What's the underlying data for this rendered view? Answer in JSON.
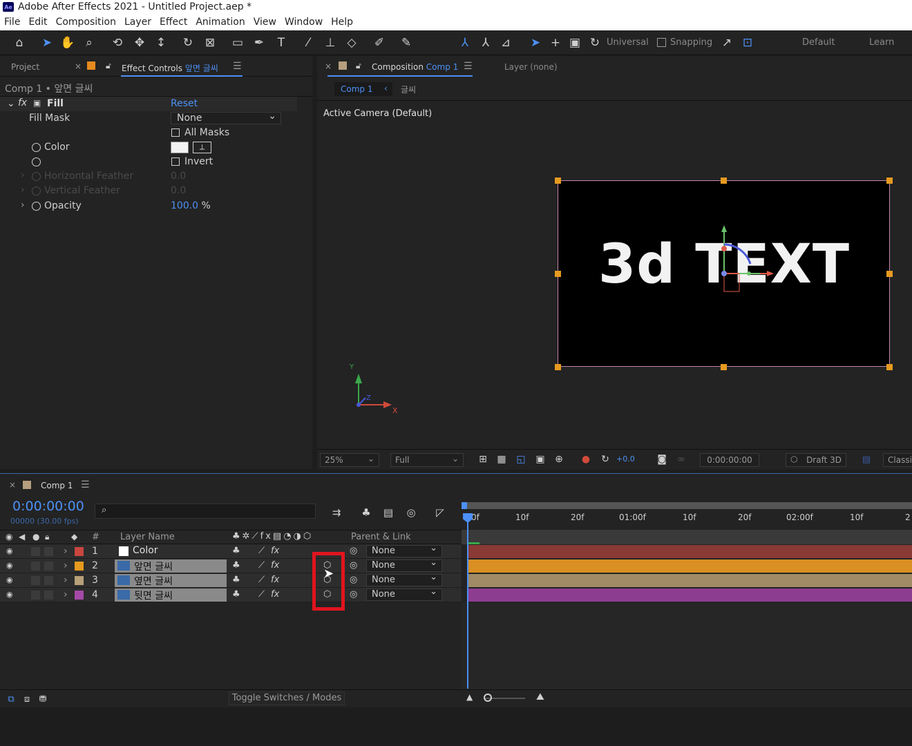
{
  "app": {
    "title": "Adobe After Effects 2021 - Untitled Project.aep *",
    "logo": "Ae"
  },
  "menu": [
    "File",
    "Edit",
    "Composition",
    "Layer",
    "Effect",
    "Animation",
    "View",
    "Window",
    "Help"
  ],
  "toolbar": {
    "universal": "Universal",
    "snapping": "Snapping",
    "workspace_default": "Default",
    "workspace_learn": "Learn"
  },
  "effect_panel": {
    "project_tab": "Project",
    "tab_label": "Effect Controls",
    "tab_layer": "앞면 글씨",
    "breadcrumb": "Comp 1 • 앞면 글씨",
    "effect_name": "Fill",
    "reset": "Reset",
    "fill_mask_label": "Fill Mask",
    "fill_mask_value": "None",
    "all_masks": "All Masks",
    "color_label": "Color",
    "invert": "Invert",
    "h_feather_label": "Horizontal Feather",
    "h_feather_value": "0.0",
    "v_feather_label": "Vertical Feather",
    "v_feather_value": "0.0",
    "opacity_label": "Opacity",
    "opacity_value": "100.0",
    "opacity_unit": "%"
  },
  "comp_panel": {
    "tab_label": "Composition",
    "tab_comp": "Comp 1",
    "layer_tab": "Layer (none)",
    "crumb_comp": "Comp 1",
    "crumb_layer": "글씨",
    "camera_label": "Active Camera (Default)",
    "comp_text": "3d TEXT",
    "axis_y": "Y",
    "axis_z": "Z",
    "axis_x": "X",
    "zoom": "25%",
    "resolution": "Full",
    "exposure": "+0.0",
    "timecode": "0:00:00:00",
    "renderer": "Draft 3D",
    "classic": "Classi"
  },
  "timeline": {
    "tab": "Comp 1",
    "timecode": "0:00:00:00",
    "frames": "00000 (30.00 fps)",
    "col_num": "#",
    "col_layer_name": "Layer Name",
    "col_parent": "Parent & Link",
    "ruler": [
      "0f",
      "10f",
      "20f",
      "01:00f",
      "10f",
      "20f",
      "02:00f",
      "10f",
      "2"
    ],
    "layers": [
      {
        "num": "1",
        "name": "Color",
        "parent": "None",
        "label_color": "#c8463f",
        "track_color": "#8a3a34"
      },
      {
        "num": "2",
        "name": "앞면 글씨",
        "parent": "None",
        "label_color": "#e69a1f",
        "track_color": "#d98f22"
      },
      {
        "num": "3",
        "name": "옆면 글씨",
        "parent": "None",
        "label_color": "#b7a07a",
        "track_color": "#a08b66"
      },
      {
        "num": "4",
        "name": "뒷면 글씨",
        "parent": "None",
        "label_color": "#a54aa8",
        "track_color": "#8d3d90"
      }
    ],
    "toggle": "Toggle Switches / Modes"
  },
  "colors": {
    "accent": "#4d90f5",
    "highlight_box": "#e0141e",
    "comp_border": "#c586b0",
    "handle": "#e69a1f"
  }
}
